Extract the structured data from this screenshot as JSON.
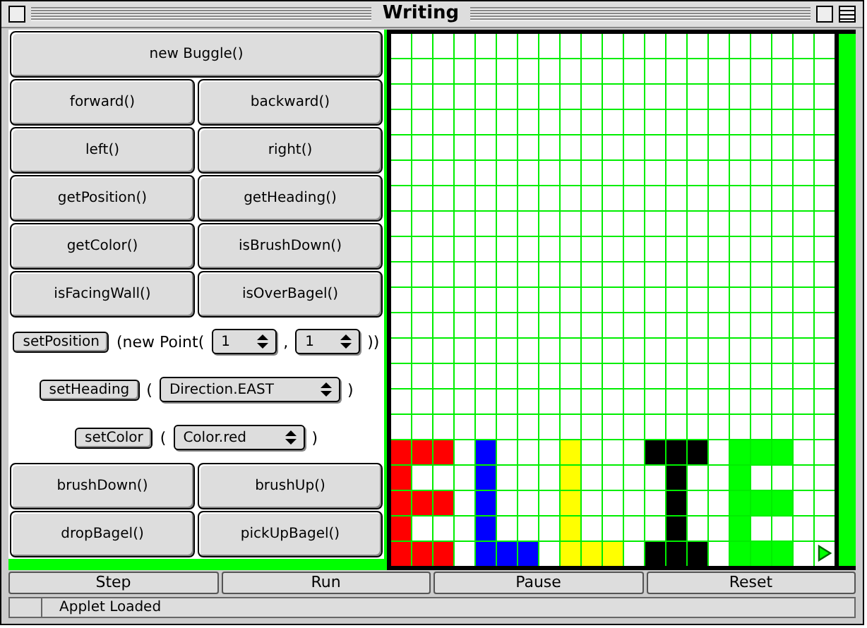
{
  "window": {
    "title": "Writing"
  },
  "command_rows": [
    {
      "kind": "buttons",
      "buttons": [
        "new Buggle()"
      ]
    },
    {
      "kind": "buttons",
      "buttons": [
        "forward()",
        "backward()"
      ]
    },
    {
      "kind": "buttons",
      "buttons": [
        "left()",
        "right()"
      ]
    },
    {
      "kind": "buttons",
      "buttons": [
        "getPosition()",
        "getHeading()"
      ]
    },
    {
      "kind": "buttons",
      "buttons": [
        "getColor()",
        "isBrushDown()"
      ]
    },
    {
      "kind": "buttons",
      "buttons": [
        "isFacingWall()",
        "isOverBagel()"
      ]
    },
    {
      "kind": "call",
      "button": "setPosition",
      "parts": [
        {
          "kind": "text",
          "text": "(new Point("
        },
        {
          "kind": "select",
          "value": "1"
        },
        {
          "kind": "text",
          "text": ","
        },
        {
          "kind": "select",
          "value": "1"
        },
        {
          "kind": "text",
          "text": "))"
        }
      ]
    },
    {
      "kind": "call",
      "button": "setHeading",
      "parts": [
        {
          "kind": "text",
          "text": "("
        },
        {
          "kind": "select",
          "value": "Direction.EAST"
        },
        {
          "kind": "text",
          "text": ")"
        }
      ]
    },
    {
      "kind": "call",
      "button": "setColor",
      "parts": [
        {
          "kind": "text",
          "text": "("
        },
        {
          "kind": "select",
          "value": "Color.red"
        },
        {
          "kind": "text",
          "text": ")"
        }
      ]
    },
    {
      "kind": "buttons",
      "buttons": [
        "brushDown()",
        "brushUp()"
      ]
    },
    {
      "kind": "buttons",
      "buttons": [
        "dropBagel()",
        "pickUpBagel()"
      ]
    }
  ],
  "world": {
    "rows": [
      [
        null,
        null,
        null,
        null,
        null,
        null,
        null,
        null,
        null,
        null,
        null,
        null,
        null,
        null,
        null,
        null,
        null,
        null,
        null,
        null,
        null
      ],
      [
        null,
        null,
        null,
        null,
        null,
        null,
        null,
        null,
        null,
        null,
        null,
        null,
        null,
        null,
        null,
        null,
        null,
        null,
        null,
        null,
        null
      ],
      [
        null,
        null,
        null,
        null,
        null,
        null,
        null,
        null,
        null,
        null,
        null,
        null,
        null,
        null,
        null,
        null,
        null,
        null,
        null,
        null,
        null
      ],
      [
        null,
        null,
        null,
        null,
        null,
        null,
        null,
        null,
        null,
        null,
        null,
        null,
        null,
        null,
        null,
        null,
        null,
        null,
        null,
        null,
        null
      ],
      [
        null,
        null,
        null,
        null,
        null,
        null,
        null,
        null,
        null,
        null,
        null,
        null,
        null,
        null,
        null,
        null,
        null,
        null,
        null,
        null,
        null
      ],
      [
        null,
        null,
        null,
        null,
        null,
        null,
        null,
        null,
        null,
        null,
        null,
        null,
        null,
        null,
        null,
        null,
        null,
        null,
        null,
        null,
        null
      ],
      [
        null,
        null,
        null,
        null,
        null,
        null,
        null,
        null,
        null,
        null,
        null,
        null,
        null,
        null,
        null,
        null,
        null,
        null,
        null,
        null,
        null
      ],
      [
        null,
        null,
        null,
        null,
        null,
        null,
        null,
        null,
        null,
        null,
        null,
        null,
        null,
        null,
        null,
        null,
        null,
        null,
        null,
        null,
        null
      ],
      [
        null,
        null,
        null,
        null,
        null,
        null,
        null,
        null,
        null,
        null,
        null,
        null,
        null,
        null,
        null,
        null,
        null,
        null,
        null,
        null,
        null
      ],
      [
        null,
        null,
        null,
        null,
        null,
        null,
        null,
        null,
        null,
        null,
        null,
        null,
        null,
        null,
        null,
        null,
        null,
        null,
        null,
        null,
        null
      ],
      [
        null,
        null,
        null,
        null,
        null,
        null,
        null,
        null,
        null,
        null,
        null,
        null,
        null,
        null,
        null,
        null,
        null,
        null,
        null,
        null,
        null
      ],
      [
        null,
        null,
        null,
        null,
        null,
        null,
        null,
        null,
        null,
        null,
        null,
        null,
        null,
        null,
        null,
        null,
        null,
        null,
        null,
        null,
        null
      ],
      [
        null,
        null,
        null,
        null,
        null,
        null,
        null,
        null,
        null,
        null,
        null,
        null,
        null,
        null,
        null,
        null,
        null,
        null,
        null,
        null,
        null
      ],
      [
        null,
        null,
        null,
        null,
        null,
        null,
        null,
        null,
        null,
        null,
        null,
        null,
        null,
        null,
        null,
        null,
        null,
        null,
        null,
        null,
        null
      ],
      [
        null,
        null,
        null,
        null,
        null,
        null,
        null,
        null,
        null,
        null,
        null,
        null,
        null,
        null,
        null,
        null,
        null,
        null,
        null,
        null,
        null
      ],
      [
        null,
        null,
        null,
        null,
        null,
        null,
        null,
        null,
        null,
        null,
        null,
        null,
        null,
        null,
        null,
        null,
        null,
        null,
        null,
        null,
        null
      ],
      [
        {
          "color": "#ff0000"
        },
        {
          "color": "#ff0000"
        },
        {
          "color": "#ff0000"
        },
        null,
        {
          "color": "#0000ff"
        },
        null,
        null,
        null,
        {
          "color": "#ffff00"
        },
        null,
        null,
        null,
        {
          "color": "#000000"
        },
        {
          "color": "#000000"
        },
        {
          "color": "#000000"
        },
        null,
        {
          "color": "#00ff00"
        },
        {
          "color": "#00ff00"
        },
        {
          "color": "#00ff00"
        },
        null,
        null
      ],
      [
        {
          "color": "#ff0000"
        },
        null,
        null,
        null,
        {
          "color": "#0000ff"
        },
        null,
        null,
        null,
        {
          "color": "#ffff00"
        },
        null,
        null,
        null,
        null,
        {
          "color": "#000000"
        },
        null,
        null,
        {
          "color": "#00ff00"
        },
        null,
        null,
        null,
        null
      ],
      [
        {
          "color": "#ff0000"
        },
        {
          "color": "#ff0000"
        },
        {
          "color": "#ff0000"
        },
        null,
        {
          "color": "#0000ff"
        },
        null,
        null,
        null,
        {
          "color": "#ffff00"
        },
        null,
        null,
        null,
        null,
        {
          "color": "#000000"
        },
        null,
        null,
        {
          "color": "#00ff00"
        },
        {
          "color": "#00ff00"
        },
        {
          "color": "#00ff00"
        },
        null,
        null
      ],
      [
        {
          "color": "#ff0000"
        },
        null,
        null,
        null,
        {
          "color": "#0000ff"
        },
        null,
        null,
        null,
        {
          "color": "#ffff00"
        },
        null,
        null,
        null,
        null,
        {
          "color": "#000000"
        },
        null,
        null,
        {
          "color": "#00ff00"
        },
        null,
        null,
        null,
        null
      ],
      [
        {
          "color": "#ff0000"
        },
        {
          "color": "#ff0000"
        },
        {
          "color": "#ff0000"
        },
        null,
        {
          "color": "#0000ff"
        },
        {
          "color": "#0000ff"
        },
        {
          "color": "#0000ff"
        },
        null,
        {
          "color": "#ffff00"
        },
        {
          "color": "#ffff00"
        },
        {
          "color": "#ffff00"
        },
        null,
        {
          "color": "#000000"
        },
        {
          "color": "#000000"
        },
        {
          "color": "#000000"
        },
        null,
        {
          "color": "#00ff00"
        },
        {
          "color": "#00ff00"
        },
        {
          "color": "#00ff00"
        },
        null,
        {
          "kind": "buggle",
          "color": "#00ff00"
        }
      ]
    ]
  },
  "controls": [
    "Step",
    "Run",
    "Pause",
    "Reset"
  ],
  "status": "Applet Loaded"
}
